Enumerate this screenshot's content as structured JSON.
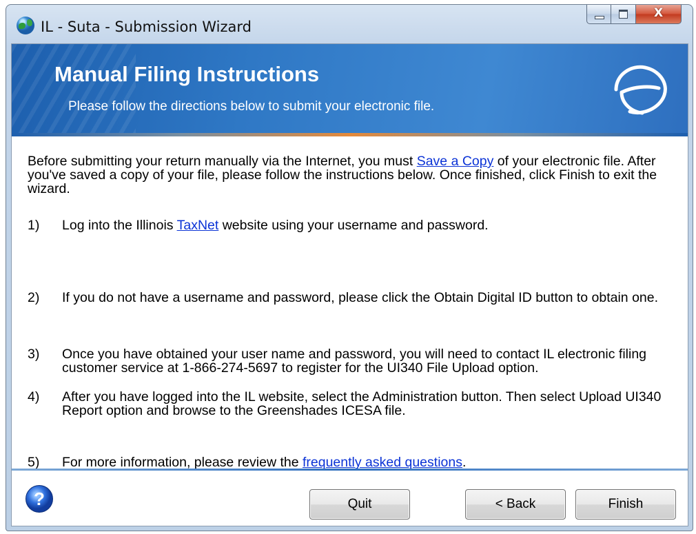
{
  "window": {
    "title": "IL - Suta - Submission Wizard",
    "close_glyph": "X"
  },
  "banner": {
    "title": "Manual Filing Instructions",
    "subtitle": "Please follow the directions below to submit your electronic file."
  },
  "intro": {
    "part1": "Before submitting your return manually via the Internet, you must ",
    "link": "Save a Copy",
    "part2": " of your electronic file.  After you've saved a copy of your file, please follow the instructions below.  Once finished, click Finish to exit the wizard."
  },
  "steps": [
    {
      "num": "1)",
      "text_before": "Log into the Illinois ",
      "link": "TaxNet",
      "text_after": " website using your username and password."
    },
    {
      "num": "2)",
      "text": "If you do not have a username and password, please click the Obtain Digital ID button to obtain one."
    },
    {
      "num": "3)",
      "text": "Once you have obtained your user name and password, you will need to contact IL electronic filing customer service at 1-866-274-5697 to register for the UI340 File Upload option."
    },
    {
      "num": "4)",
      "text": "After you have logged into the IL website, select the Administration button.  Then select Upload UI340 Report option and browse to the Greenshades ICESA file."
    },
    {
      "num": "5)",
      "text_before": "For more information, please review the ",
      "link": "frequently asked questions",
      "text_after": "."
    }
  ],
  "footer": {
    "help_glyph": "?",
    "quit_label": "Quit",
    "back_label": "< Back",
    "finish_label": "Finish"
  },
  "colors": {
    "banner_blue": "#2f78c5",
    "link": "#0b33d6",
    "accent_line": "#e58a3a"
  }
}
